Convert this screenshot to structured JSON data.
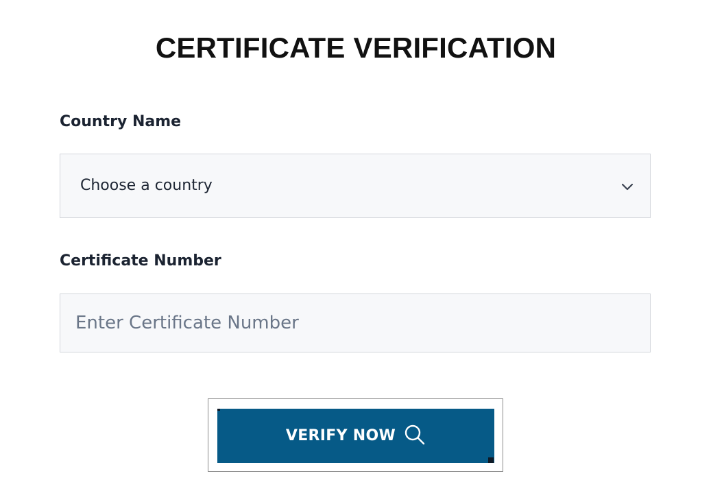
{
  "page": {
    "title": "CERTIFICATE VERIFICATION"
  },
  "form": {
    "country": {
      "label": "Country Name",
      "selected_value": "Choose a country",
      "icon": "chevron-down-icon"
    },
    "certificate": {
      "label": "Certificate Number",
      "value": "",
      "placeholder": "Enter Certificate Number"
    },
    "submit": {
      "label": "VERIFY NOW",
      "icon": "search-icon"
    }
  },
  "colors": {
    "button_background": "#065a87",
    "button_text": "#ffffff",
    "field_background": "#f7f8fa",
    "field_border": "#d3d6db",
    "label_text": "#1b2331",
    "placeholder_text": "#6a7688",
    "title_text": "#111111"
  }
}
